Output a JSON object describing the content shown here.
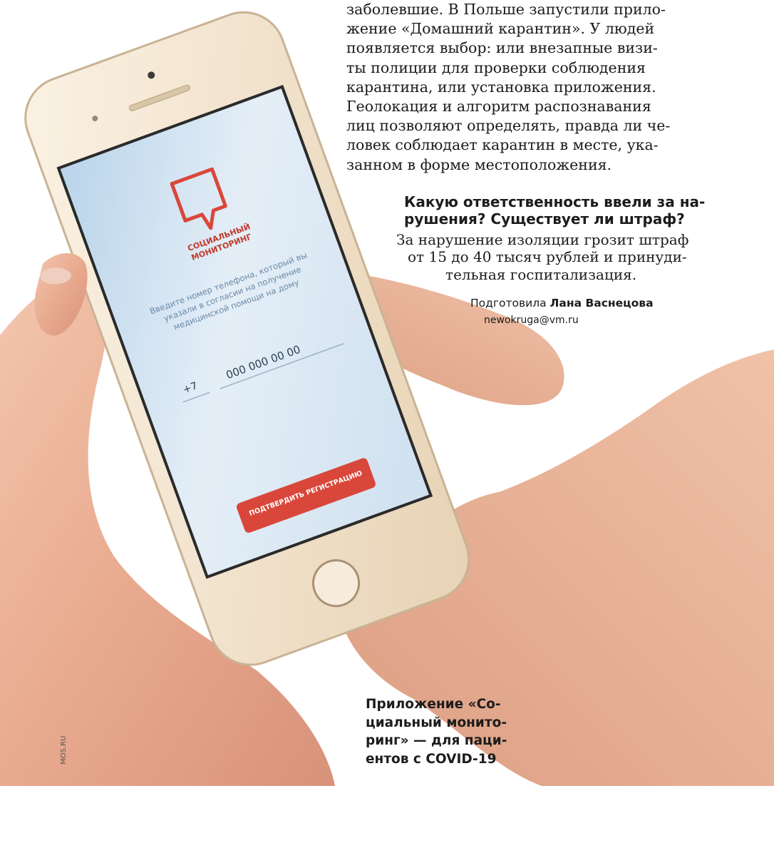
{
  "article": {
    "lines": [
      "заболевшие. В Польше запустили прило-",
      "жение «Домашний карантин». У людей",
      "появляется выбор: или внезапные визи-",
      "ты полиции для проверки соблюдения",
      "карантина, или установка приложения.",
      "Геолокация и алгоритм распознавания",
      "лиц позволяют определять, правда ли че-",
      "ловек соблюдает карантин в месте, ука-",
      "занном в форме местоположения."
    ]
  },
  "qa": {
    "question_line1": "Какую ответственность ввели за на-",
    "question_line2": "рушения? Существует ли штраф?",
    "answer_line1": "За нарушение изоляции грозит штраф",
    "answer_line2": "от 15 до 40 тысяч рублей и принуди-",
    "answer_line3": "тельная госпитализация."
  },
  "byline": {
    "prefix": "Подготовила",
    "author": "Лана Васнецова",
    "email": "newokruga@vm.ru"
  },
  "caption": {
    "lines": [
      "Приложение «Со-",
      "циальный монито-",
      "ринг» — для паци-",
      "ентов с COVID-19"
    ]
  },
  "photo_credit": "MOS.RU",
  "phone_app": {
    "logo_title_line1": "СОЦИАЛЬНЫЙ",
    "logo_title_line2": "МОНИТОРИНГ",
    "instruction_line1": "Введите номер телефона, который вы",
    "instruction_line2": "указали в согласии на получение",
    "instruction_line3": "медицинской помощи на дому",
    "country_code": "+7",
    "phone_placeholder": "000 000 00 00",
    "confirm_button": "ПОДТВЕРДИТЬ РЕГИСТРАЦИЮ"
  },
  "colors": {
    "accent_red": "#d9473a",
    "screen_bg": "#dde9f3",
    "phone_body": "#f4e7d3",
    "skin": "#e9b39a"
  }
}
